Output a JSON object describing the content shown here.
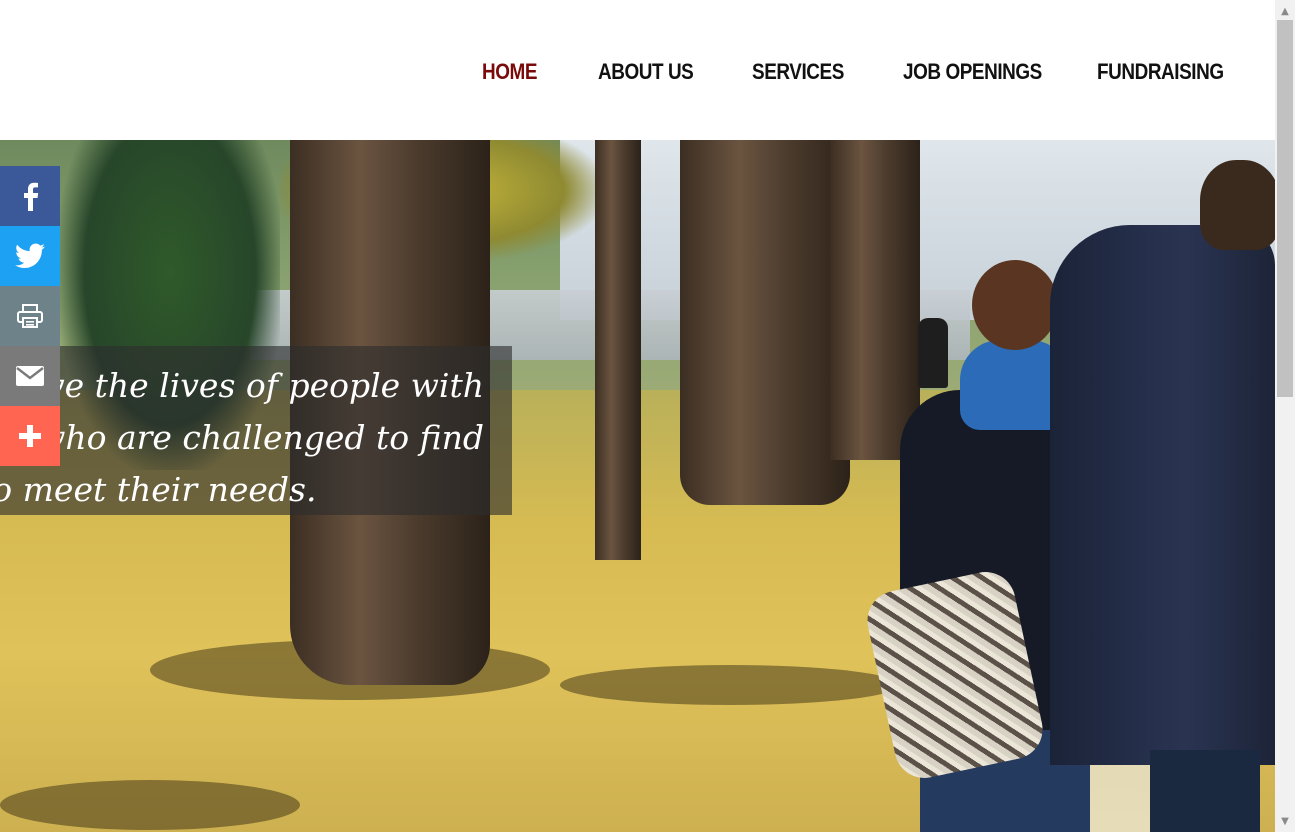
{
  "nav": {
    "items": [
      {
        "label": "HOME",
        "active": true
      },
      {
        "label": "ABOUT US",
        "active": false
      },
      {
        "label": "SERVICES",
        "active": false
      },
      {
        "label": "JOB OPENINGS",
        "active": false
      },
      {
        "label": "FUNDRAISING",
        "active": false
      }
    ],
    "active_color": "#7a0a0a",
    "text_color": "#111111"
  },
  "hero": {
    "quote_lines": [
      "To improve the lives of people with",
      "disabilities who are challenged to find",
      "to meet their needs."
    ],
    "overlay_color": "rgba(45,45,45,0.62)"
  },
  "share": {
    "buttons": [
      {
        "name": "facebook",
        "icon": "facebook-icon",
        "color": "#3b5998"
      },
      {
        "name": "twitter",
        "icon": "twitter-icon",
        "color": "#1da1f2"
      },
      {
        "name": "print",
        "icon": "print-icon",
        "color": "#6d8389"
      },
      {
        "name": "email",
        "icon": "email-icon",
        "color": "#7a7a7a"
      },
      {
        "name": "more",
        "icon": "plus-icon",
        "color": "#ff6550"
      }
    ]
  },
  "scrollbar": {
    "up_arrow": "▲",
    "down_arrow": "▼"
  }
}
